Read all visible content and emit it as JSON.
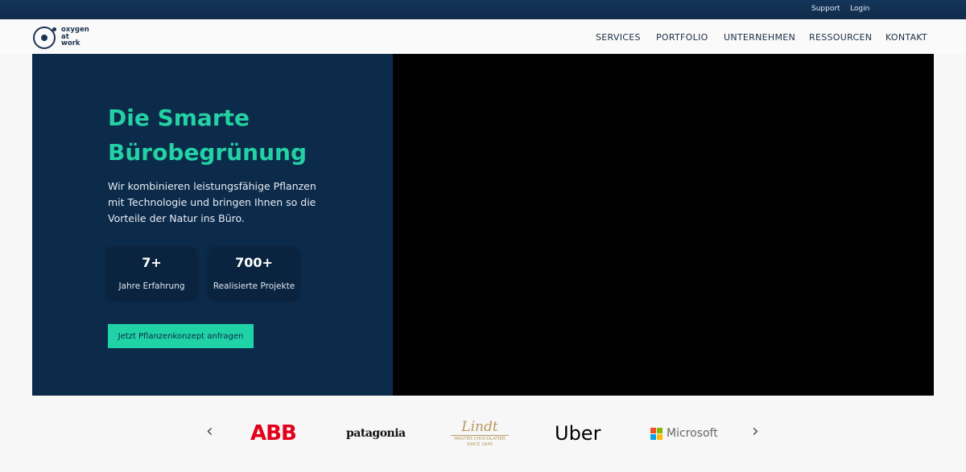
{
  "topbar": {
    "support_label": "Support",
    "login_label": "Login"
  },
  "logo": {
    "line1": "oxygen",
    "line2": "at",
    "line3": "work"
  },
  "nav": {
    "items": [
      {
        "label": "SERVICES"
      },
      {
        "label": "PORTFOLIO"
      },
      {
        "label": "UNTERNEHMEN"
      },
      {
        "label": "RESSOURCEN"
      },
      {
        "label": "KONTAKT"
      }
    ]
  },
  "hero": {
    "title_line1": "Die Smarte",
    "title_line2": "Bürobegrünung",
    "description": "Wir kombinieren leistungsfähige Pflanzen mit Technologie und bringen Ihnen so die Vorteile der Natur ins Büro.",
    "stats": [
      {
        "value": "7+",
        "label": "Jahre Erfahrung"
      },
      {
        "value": "700+",
        "label": "Realisierte Projekte"
      }
    ],
    "cta_label": "Jetzt Pflanzenkonzept anfragen"
  },
  "clients": {
    "prev_icon": "chevron-left-icon",
    "next_icon": "chevron-right-icon",
    "logos": {
      "abb": "ABB",
      "patagonia": "patagonia",
      "lindt_name": "Lindt",
      "lindt_sub1": "MASTER CHOCOLATIER",
      "lindt_sub2": "SINCE 1845",
      "uber": "Uber",
      "microsoft": "Microsoft"
    }
  },
  "colors": {
    "topbar": "#0f2c4c",
    "hero_bg": "#0c2a4a",
    "accent": "#23d1a4",
    "abb_red": "#e2001a",
    "lindt_gold": "#b89a5b"
  }
}
